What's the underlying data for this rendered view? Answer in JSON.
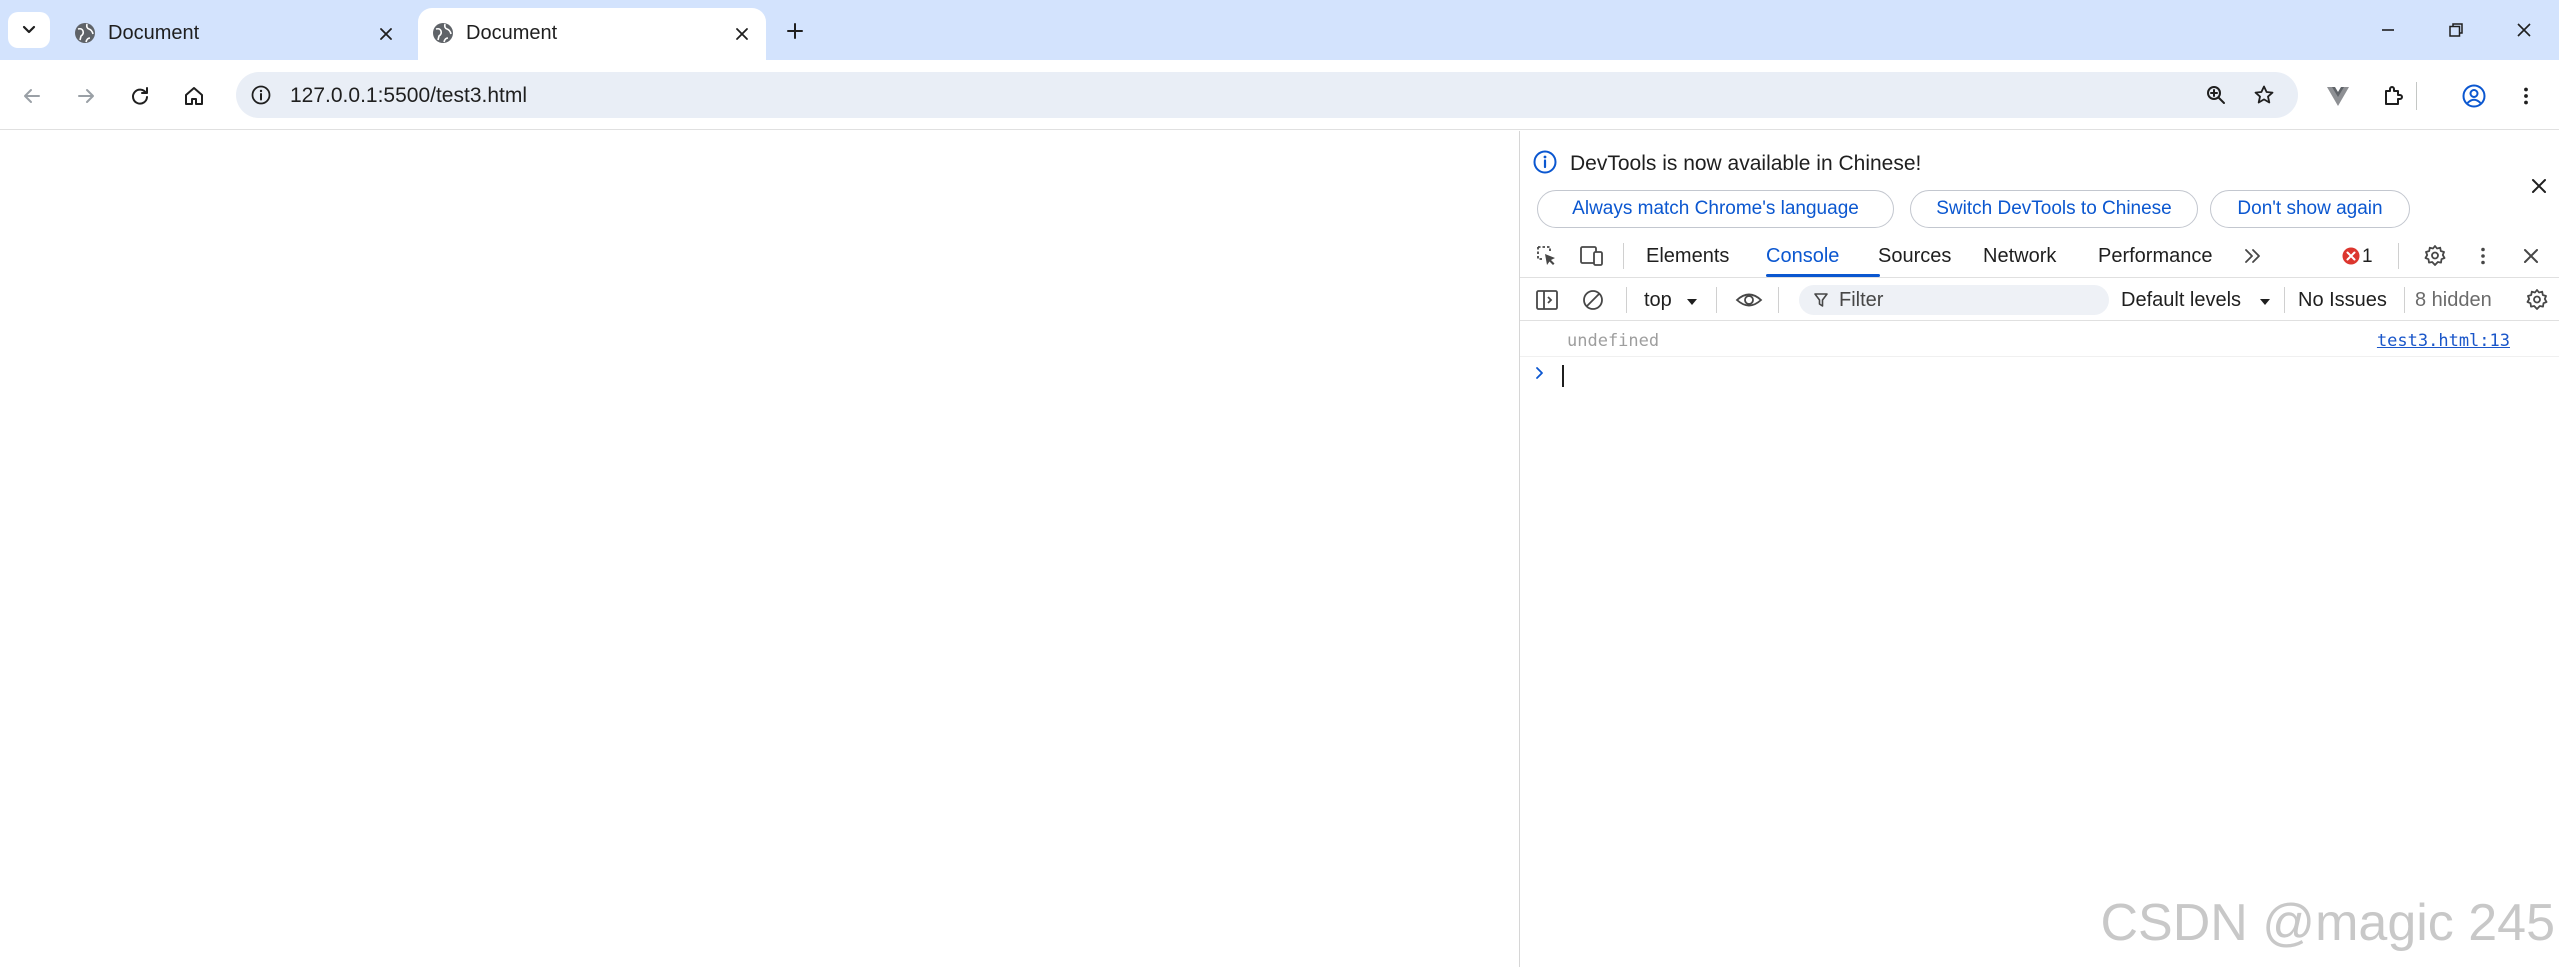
{
  "browser": {
    "tabs": [
      {
        "title": "Document",
        "active": false
      },
      {
        "title": "Document",
        "active": true
      }
    ],
    "url": "127.0.0.1:5500/test3.html",
    "accent_color": "#0b57d0",
    "tabstrip_color": "#d3e3fd"
  },
  "devtools": {
    "infobar": {
      "message": "DevTools is now available in Chinese!",
      "buttons": [
        "Always match Chrome's language",
        "Switch DevTools to Chinese",
        "Don't show again"
      ]
    },
    "tabs": [
      "Elements",
      "Console",
      "Sources",
      "Network",
      "Performance"
    ],
    "active_tab": "Console",
    "error_count": "1",
    "console_toolbar": {
      "context": "top",
      "filter_placeholder": "Filter",
      "levels": "Default levels",
      "issues": "No Issues",
      "hidden": "8 hidden"
    },
    "messages": [
      {
        "text": "undefined",
        "source": "test3.html:13"
      }
    ]
  },
  "watermark": "CSDN @magic 245"
}
